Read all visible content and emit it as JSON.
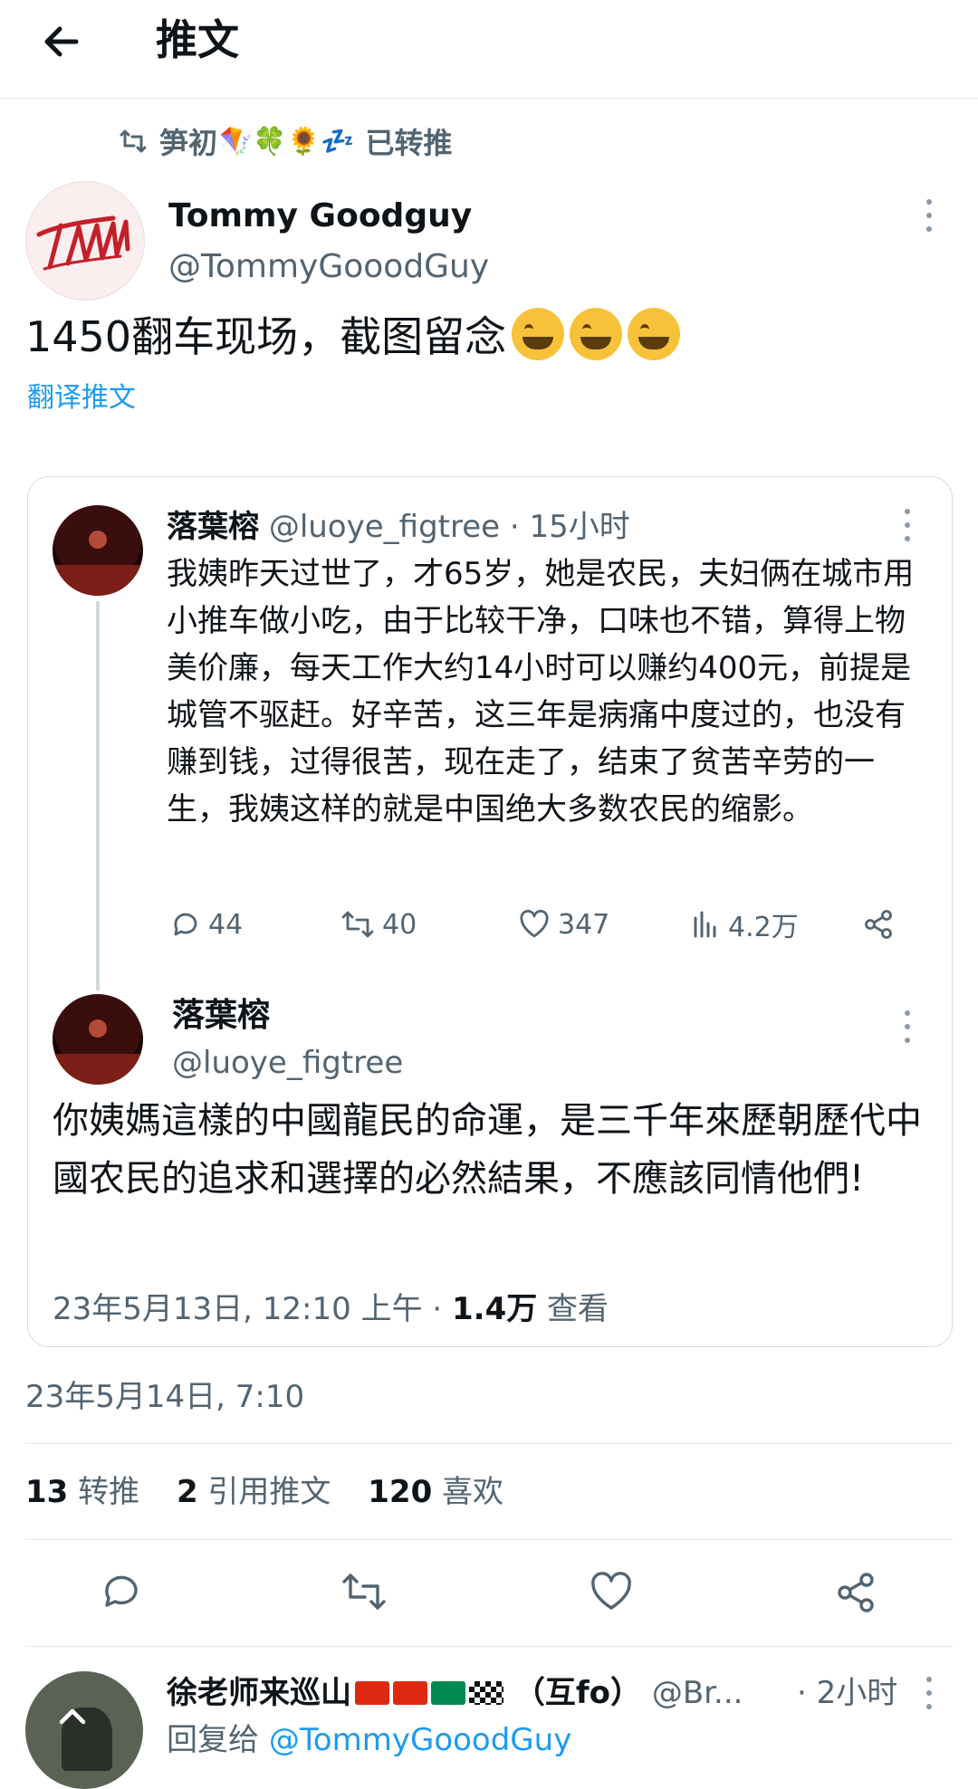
{
  "header": {
    "title": "推文"
  },
  "retweet": {
    "user": "笋初",
    "emoji": "🪁🍀🌻💤",
    "label": "已转推"
  },
  "tweet": {
    "author_name": "Tommy Goodguy",
    "author_handle": "@TommyGooodGuy",
    "text": "1450翻车现场，截图留念",
    "translate_label": "翻译推文",
    "timestamp": "23年5月14日, 7:10"
  },
  "quote1": {
    "name": "落葉榕",
    "handle": "@luoye_figtree",
    "time": "· 15小时",
    "text": "我姨昨天过世了，才65岁，她是农民，夫妇俩在城市用小推车做小吃，由于比较干净，口味也不错，算得上物美价廉，每天工作大约14小时可以赚约400元，前提是城管不驱赶。好辛苦，这三年是病痛中度过的，也没有赚到钱，过得很苦，现在走了，结束了贫苦辛劳的一生，我姨这样的就是中国绝大多数农民的缩影。",
    "replies": "44",
    "retweets": "40",
    "likes": "347",
    "views": "4.2万"
  },
  "quote2": {
    "name": "落葉榕",
    "handle": "@luoye_figtree",
    "text": "你姨媽這樣的中國龍民的命運，是三千年來歷朝歷代中國农民的追求和選擇的必然結果，不應該同情他們!",
    "date": "23年5月13日, 12:10 上午 · ",
    "views": "1.4万",
    "views_label": " 查看"
  },
  "stats": {
    "retweets_count": "13",
    "retweets_label": "转推",
    "quotes_count": "2",
    "quotes_label": "引用推文",
    "likes_count": "120",
    "likes_label": "喜欢"
  },
  "reply": {
    "name": "徐老师来巡山",
    "suffix": "（互fo）",
    "handle": "@Br...",
    "time": "· 2小时",
    "reply_prefix": "回复给 ",
    "reply_to": "@TommyGooodGuy"
  }
}
